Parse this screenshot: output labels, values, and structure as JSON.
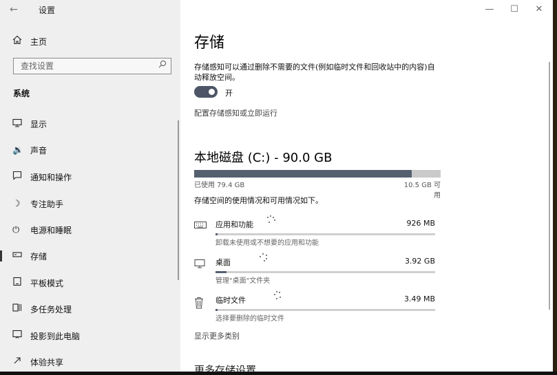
{
  "window": {
    "title": "设置",
    "back_icon": "arrow-left-icon",
    "controls": [
      "minimize-icon",
      "maximize-icon",
      "close-icon"
    ]
  },
  "sidebar": {
    "home_label": "主页",
    "search_placeholder": "查找设置",
    "section_title": "系统",
    "items": [
      {
        "label": "显示",
        "icon": "monitor-icon"
      },
      {
        "label": "声音",
        "icon": "speaker-icon"
      },
      {
        "label": "通知和操作",
        "icon": "notification-icon"
      },
      {
        "label": "专注助手",
        "icon": "moon-icon"
      },
      {
        "label": "电源和睡眠",
        "icon": "power-icon"
      },
      {
        "label": "存储",
        "icon": "storage-icon",
        "active": true
      },
      {
        "label": "平板模式",
        "icon": "tablet-icon"
      },
      {
        "label": "多任务处理",
        "icon": "multitask-icon"
      },
      {
        "label": "投影到此电脑",
        "icon": "project-icon"
      },
      {
        "label": "体验共享",
        "icon": "share-icon"
      }
    ]
  },
  "main": {
    "title": "存储",
    "description": "存储感知可以通过删除不需要的文件(例如临时文件和回收站中的内容)自动释放空间。",
    "toggle_label": "开",
    "toggle_on": true,
    "config_link": "配置存储感知或立即运行",
    "disk_title": "本地磁盘 (C:) - 90.0 GB",
    "disk_used_fraction": 0.882,
    "used_text": "已使用 79.4 GB",
    "free_text": "10.5 GB 可用",
    "usage_header": "存储空间的使用情况和可用情况如下。",
    "categories": [
      {
        "name": "应用和功能",
        "size": "926 MB",
        "sub": "卸载未使用或不想要的应用和功能",
        "fraction": 0.01,
        "icon": "keyboard-icon"
      },
      {
        "name": "桌面",
        "size": "3.92 GB",
        "sub": "管理\"桌面\"文件夹",
        "fraction": 0.05,
        "icon": "desktop-icon"
      },
      {
        "name": "临时文件",
        "size": "3.49 MB",
        "sub": "选择要删除的临时文件",
        "fraction": 0.0,
        "icon": "trash-icon"
      }
    ],
    "more_link": "显示更多类别",
    "more_settings": "更多存储设置"
  }
}
